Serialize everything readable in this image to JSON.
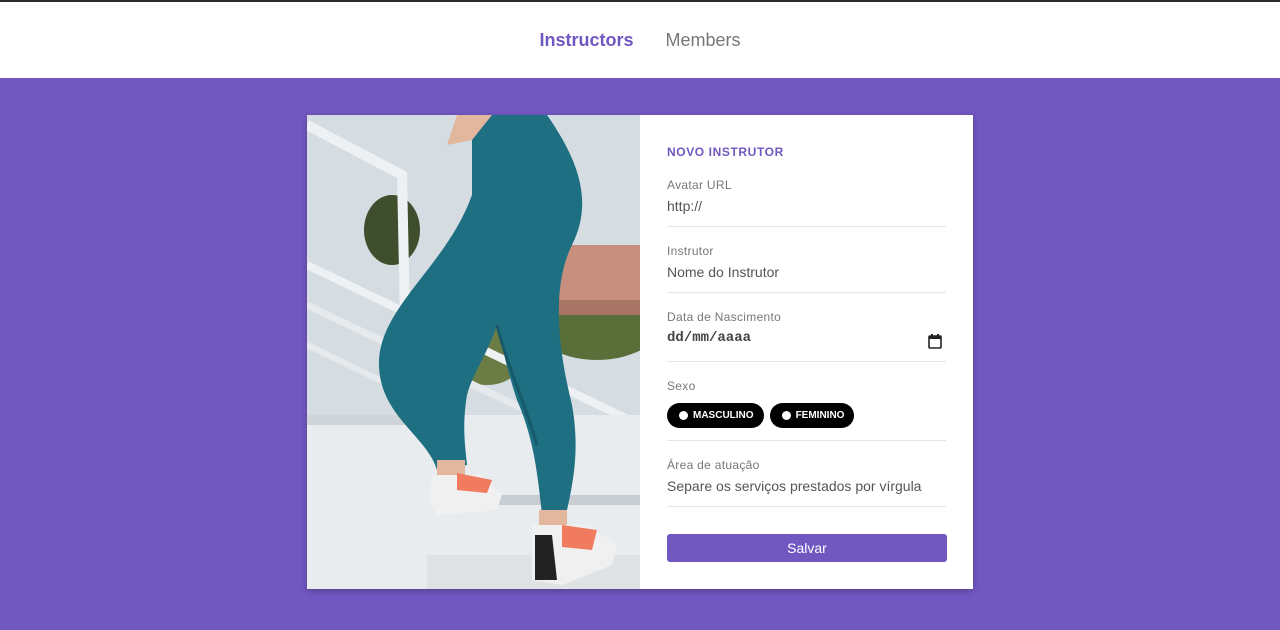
{
  "nav": {
    "items": [
      {
        "label": "Instructors",
        "active": true
      },
      {
        "label": "Members",
        "active": false
      }
    ]
  },
  "form": {
    "title": "NOVO INSTRUTOR",
    "avatar": {
      "label": "Avatar URL",
      "placeholder": "http://"
    },
    "instructor": {
      "label": "Instrutor",
      "placeholder": "Nome do Instrutor"
    },
    "birth": {
      "label": "Data de Nascimento",
      "placeholder": "dd/mm/aaaa"
    },
    "gender": {
      "label": "Sexo",
      "options": [
        "MASCULINO",
        "FEMININO"
      ]
    },
    "services": {
      "label": "Área de atuação",
      "placeholder": "Separe os serviços prestados por vírgula"
    },
    "submit_label": "Salvar"
  },
  "colors": {
    "accent": "#7157c0",
    "background": "#7157c0",
    "card": "#ffffff"
  },
  "icons": [
    "calendar-icon",
    "radio-icon"
  ]
}
